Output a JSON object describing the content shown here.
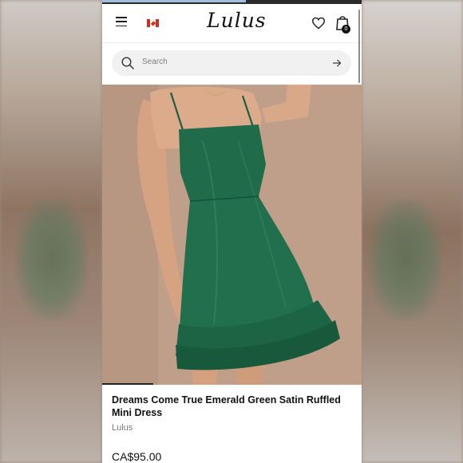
{
  "header": {
    "logo_text": "Lulus",
    "menu_icon": "hamburger-menu-icon",
    "flag_icon": "canada-flag-icon",
    "wishlist_icon": "heart-icon",
    "bag_icon": "shopping-bag-icon",
    "bag_count": "0"
  },
  "search": {
    "placeholder": "Search",
    "search_icon": "search-icon",
    "submit_icon": "arrow-right-icon"
  },
  "product": {
    "image_icon": "product-photo",
    "title": "Dreams Come True Emerald Green Satin Ruffled Mini Dress",
    "brand": "Lulus",
    "price": "CA$95.00"
  },
  "colors": {
    "dress": "#1f6b4a",
    "backdrop": "#bf9f89",
    "text": "#111111",
    "muted": "#7a7a7a"
  }
}
